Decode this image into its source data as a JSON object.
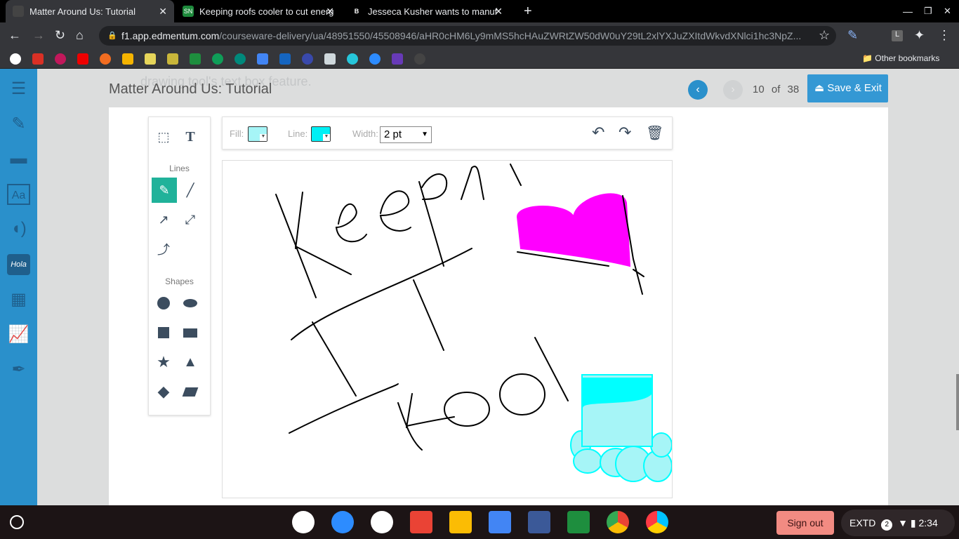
{
  "browser": {
    "tabs": [
      {
        "title": "Matter Around Us: Tutorial",
        "active": true
      },
      {
        "title": "Keeping roofs cooler to cut energ",
        "favicon_text": "SN"
      },
      {
        "title": "Jesseca Kusher wants to manuf",
        "favicon_text": "B"
      }
    ],
    "url_host": "f1.app.edmentum.com",
    "url_path": "/courseware-delivery/ua/48951550/45508946/aHR0cHM6Ly9mMS5hcHAuZWRtZW50dW0uY29tL2xlYXJuZXItdWkvdXNlci1hc3NpZ...",
    "other_bookmarks": "Other bookmarks"
  },
  "header": {
    "title": "Matter Around Us: Tutorial",
    "behind_text": "drawing tool's text box feature.",
    "page_current": "10",
    "page_of": "of",
    "page_total": "38",
    "save_exit": "Save & Exit"
  },
  "tools": {
    "lines_label": "Lines",
    "shapes_label": "Shapes"
  },
  "options": {
    "fill_label": "Fill:",
    "line_label": "Line:",
    "width_label": "Width:",
    "width_value": "2 pt",
    "fill_color": "#a6f5f7",
    "line_color": "#00f0f5"
  },
  "canvas": {
    "ink": "#000000",
    "magenta": "#ff00ff",
    "cyan": "#00ffff",
    "cyan_fill": "#a6f5f7"
  },
  "taskbar": {
    "sign_out": "Sign out",
    "extd": "EXTD",
    "badge": "2",
    "time": "2:34"
  }
}
